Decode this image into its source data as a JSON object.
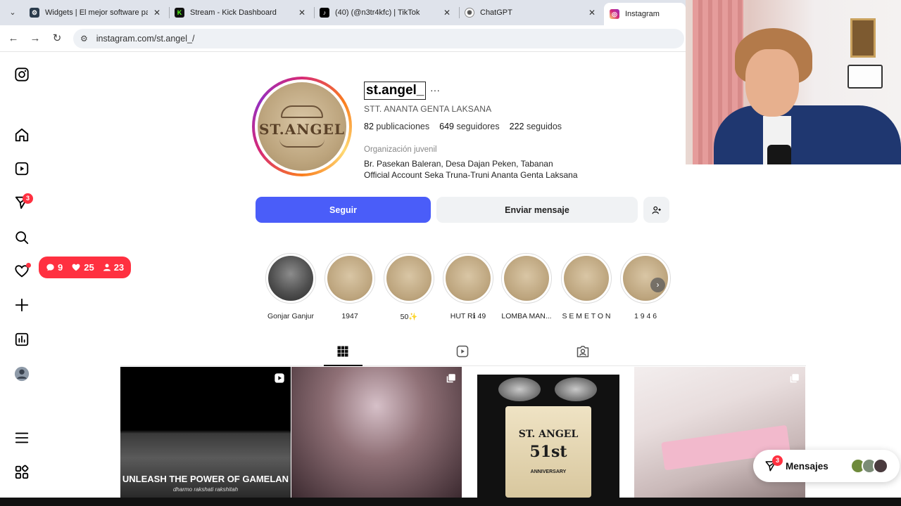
{
  "browser": {
    "tabs": [
      {
        "title": "Widgets | El mejor software para streamers",
        "favicon_color": "#2a3b4c",
        "icon": "widgets-favicon-icon"
      },
      {
        "title": "Stream - Kick Dashboard",
        "favicon_color": "#53fc18",
        "icon": "kick-favicon-icon"
      },
      {
        "title": "(40) (@n3tr4kfc) | TikTok",
        "favicon_color": "#000000",
        "icon": "tiktok-favicon-icon"
      },
      {
        "title": "ChatGPT",
        "favicon_color": "#555555",
        "icon": "chatgpt-favicon-icon"
      },
      {
        "title": "Instagram",
        "favicon_color": "#d62976",
        "icon": "instagram-favicon-icon"
      }
    ],
    "close_glyph": "✕",
    "url": "instagram.com/st.angel_/"
  },
  "nav": {
    "notifications_badge": "3",
    "notif_pill": {
      "comments": "9",
      "likes": "25",
      "follows": "23"
    }
  },
  "profile": {
    "avatar_text": "ST.ANGEL",
    "username": "st.angel_",
    "more": "···",
    "full_name": "STT. ANANTA GENTA LAKSANA",
    "stats": {
      "posts_count": "82",
      "posts_label": "publicaciones",
      "followers_count": "649",
      "followers_label": "seguidores",
      "following_count": "222",
      "following_label": "seguidos"
    },
    "category": "Organización juvenil",
    "bio_line1": "Br. Pasekan Baleran, Desa Dajan Peken, Tabanan",
    "bio_line2": "Official Account Seka Truna-Truni Ananta Genta Laksana"
  },
  "actions": {
    "follow": "Seguir",
    "message": "Enviar mensaje"
  },
  "highlights": [
    {
      "label": "Gonjar Ganjur",
      "style": "bw"
    },
    {
      "label": "1947",
      "style": "logo"
    },
    {
      "label": "50✨",
      "style": "logo"
    },
    {
      "label": "HUT Rℹ︎ 49",
      "style": "logo"
    },
    {
      "label": "LOMBA MAN...",
      "style": "logo"
    },
    {
      "label": "S E M E T O N",
      "style": "logo"
    },
    {
      "label": "1 9 4 6",
      "style": "logo"
    }
  ],
  "posts": {
    "post1_caption": "UNLEASH THE POWER OF GAMELAN",
    "post1_sub": "dharmo rakshati rakshitah",
    "post3_title": "ST. ANGEL",
    "post3_number": "51st",
    "post3_sub": "ANNIVERSARY"
  },
  "messages": {
    "label": "Mensajes",
    "badge": "3"
  },
  "colors": {
    "accent_blue": "#4a5df9",
    "badge_red": "#ff3040"
  }
}
